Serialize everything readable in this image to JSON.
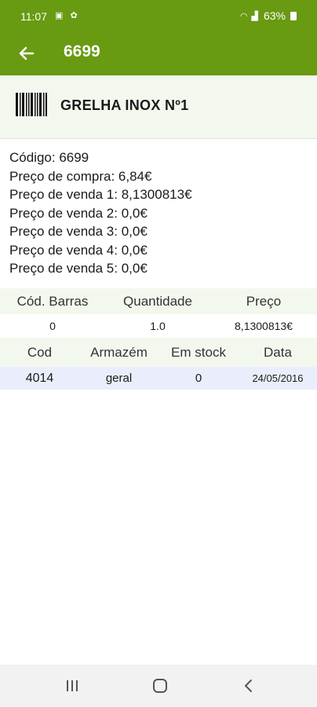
{
  "status_bar": {
    "time": "11:07",
    "battery": "63%"
  },
  "app_bar": {
    "title": "6699",
    "back_icon": "arrow-left-icon"
  },
  "product": {
    "name": "GRELHA INOX Nº1",
    "icon": "barcode-icon"
  },
  "details": [
    "Código: 6699",
    "Preço de compra: 6,84€",
    "Preço de venda 1: 8,1300813€",
    "Preço de venda 2: 0,0€",
    "Preço de venda 3: 0,0€",
    "Preço de venda 4: 0,0€",
    "Preço de venda 5: 0,0€"
  ],
  "barcode_table": {
    "headers": [
      "Cód. Barras",
      "Quantidade",
      "Preço"
    ],
    "rows": [
      [
        "0",
        "1.0",
        "8,1300813€"
      ]
    ]
  },
  "stock_table": {
    "headers": [
      "Cod",
      "Armazém",
      "Em stock",
      "Data"
    ],
    "rows": [
      [
        "4014",
        "geral",
        "0",
        "24/05/2016"
      ]
    ]
  },
  "colors": {
    "primary": "#689a12",
    "header_bg": "#f3f8ef",
    "row_highlight": "#eaeefc"
  }
}
